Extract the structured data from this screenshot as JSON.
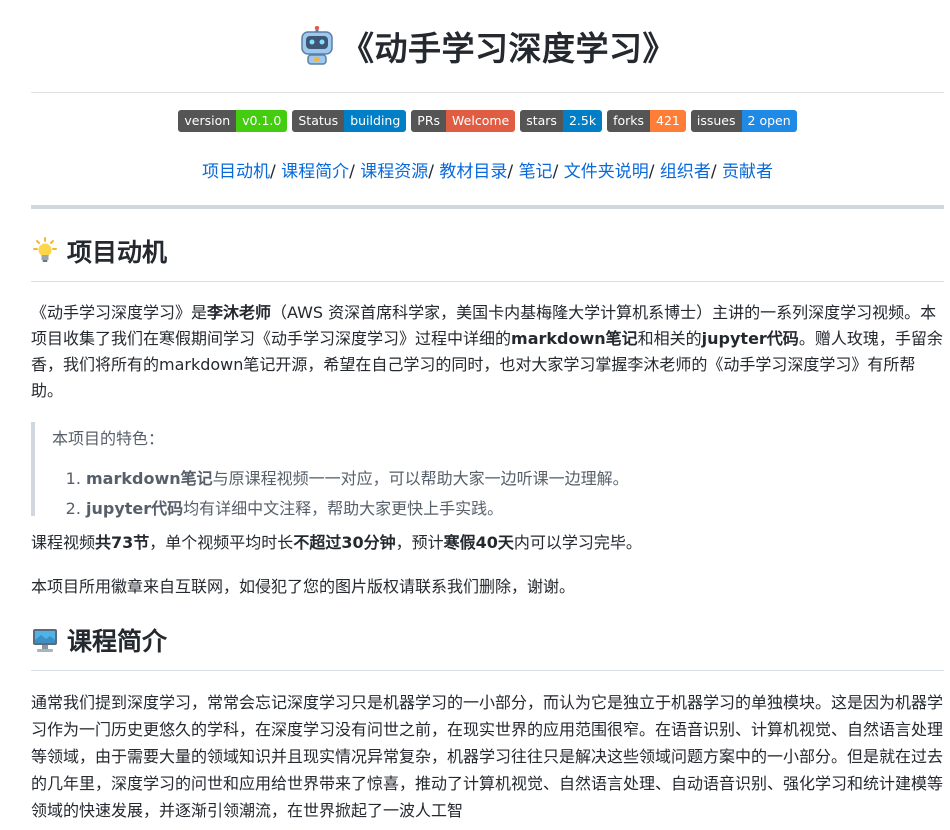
{
  "title": "《动手学习深度学习》",
  "badges": [
    {
      "label": "version",
      "value": "v0.1.0",
      "color": "#4c1"
    },
    {
      "label": "Status",
      "value": "building",
      "color": "#007ec6"
    },
    {
      "label": "PRs",
      "value": "Welcome",
      "color": "#e05d44"
    },
    {
      "label": "stars",
      "value": "2.5k",
      "color": "#007ec6"
    },
    {
      "label": "forks",
      "value": "421",
      "color": "#fe7d37"
    },
    {
      "label": "issues",
      "value": "2 open",
      "color": "#1f8ae6"
    }
  ],
  "toc": [
    "项目动机",
    "课程简介",
    "课程资源",
    "教材目录",
    "笔记",
    "文件夹说明",
    "组织者",
    "贡献者"
  ],
  "toc_sep": "/ ",
  "section1": {
    "icon": "lightbulb-icon",
    "heading": "项目动机",
    "para1": {
      "t1": "《动手学习深度学习》是",
      "b1": "李沐老师",
      "t2": "（AWS 资深首席科学家，美国卡内基梅隆大学计算机系博士）主讲的一系列深度学习视频。本项目收集了我们在寒假期间学习《动手学习深度学习》过程中详细的",
      "b2": "markdown笔记",
      "t3": "和相关的",
      "b3": "jupyter代码",
      "t4": "。赠人玫瑰，手留余香，我们将所有的markdown笔记开源，希望在自己学习的同时，也对大家学习掌握李沐老师的《动手学习深度学习》有所帮助。"
    },
    "quote": {
      "title": "本项目的特色：",
      "item1_b": "markdown笔记",
      "item1_t": "与原课程视频一一对应，可以帮助大家一边听课一边理解。",
      "item2_b": "jupyter代码",
      "item2_t": "均有详细中文注释，帮助大家更快上手实践。"
    },
    "para2": {
      "t1": "课程视频",
      "b1": "共73节",
      "t2": "，单个视频平均时长",
      "b2": "不超过30分钟",
      "t3": "，预计",
      "b3": "寒假40天",
      "t4": "内可以学习完毕。"
    },
    "para3": "本项目所用徽章来自互联网，如侵犯了您的图片版权请联系我们删除，谢谢。"
  },
  "section2": {
    "icon": "computer-icon",
    "heading": "课程简介",
    "para": "通常我们提到深度学习，常常会忘记深度学习只是机器学习的一小部分，而认为它是独立于机器学习的单独模块。这是因为机器学习作为一门历史更悠久的学科，在深度学习没有问世之前，在现实世界的应用范围很窄。在语音识别、计算机视觉、自然语言处理等领域，由于需要大量的领域知识并且现实情况异常复杂，机器学习往往只是解决这些领域问题方案中的一小部分。但是就在过去的几年里，深度学习的问世和应用给世界带来了惊喜，推动了计算机视觉、自然语言处理、自动语音识别、强化学习和统计建模等领域的快速发展，并逐渐引领潮流，在世界掀起了一波人工智"
  }
}
